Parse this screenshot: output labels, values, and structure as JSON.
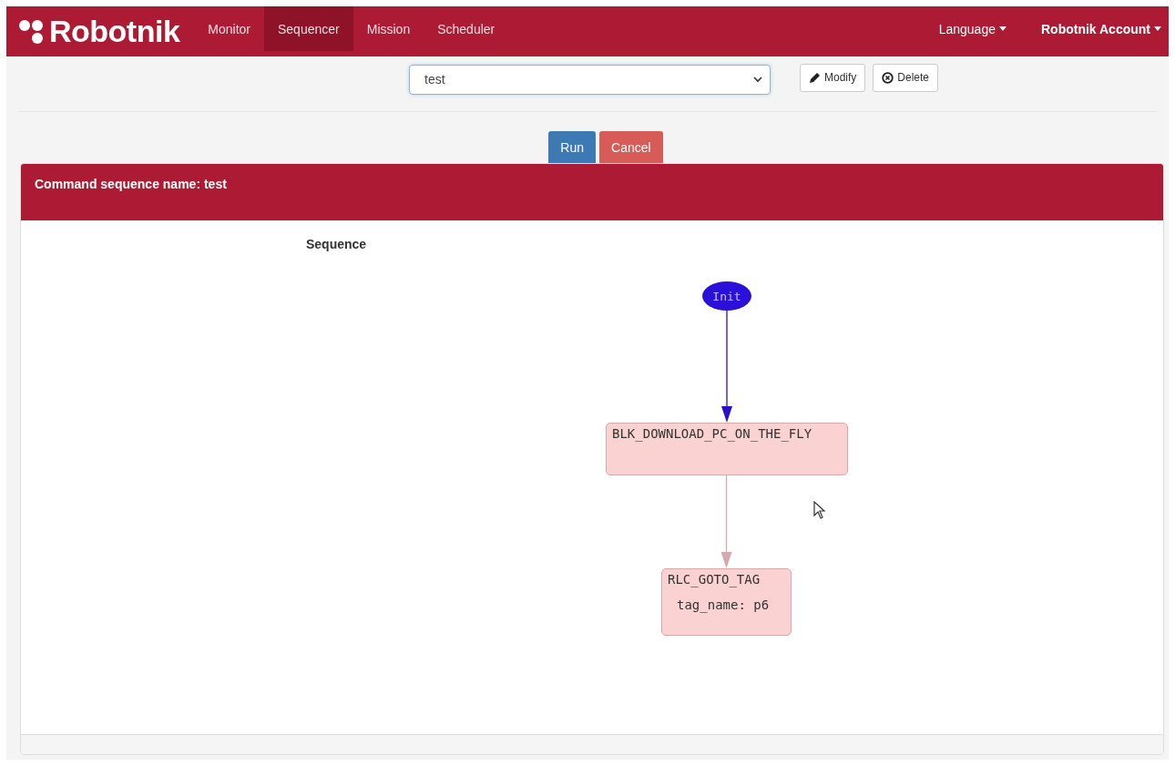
{
  "navbar": {
    "brand": "Robotnik",
    "items": [
      {
        "label": "Monitor",
        "selected": false
      },
      {
        "label": "Sequencer",
        "selected": true
      },
      {
        "label": "Mission",
        "selected": false
      },
      {
        "label": "Scheduler",
        "selected": false
      }
    ],
    "right": [
      {
        "label": "Language",
        "bold": false
      },
      {
        "label": "Robotnik Account",
        "bold": true
      }
    ]
  },
  "toolbar": {
    "select_value": "test",
    "buttons": [
      {
        "kind": "modify",
        "label": "Modify"
      },
      {
        "kind": "delete",
        "label": "Delete"
      }
    ]
  },
  "actions": [
    {
      "kind": "primary",
      "label": "Run"
    },
    {
      "kind": "danger",
      "label": "Cancel"
    }
  ],
  "panel": {
    "title": "Command sequence name: test",
    "section_label": "Sequence",
    "graph": {
      "nodes": [
        {
          "kind": "ellipse",
          "label": "Init",
          "color": "#2a10d8"
        },
        {
          "kind": "box",
          "label": "BLK_DOWNLOAD_PC_ON_THE_FLY",
          "color": "#fad2d2"
        },
        {
          "kind": "box",
          "label": "RLC_GOTO_TAG",
          "param": "tag_name: p6",
          "color": "#fad2d2"
        }
      ],
      "edges": [
        {
          "color": "#2a10c8"
        },
        {
          "color": "#d4aab0"
        }
      ]
    }
  }
}
